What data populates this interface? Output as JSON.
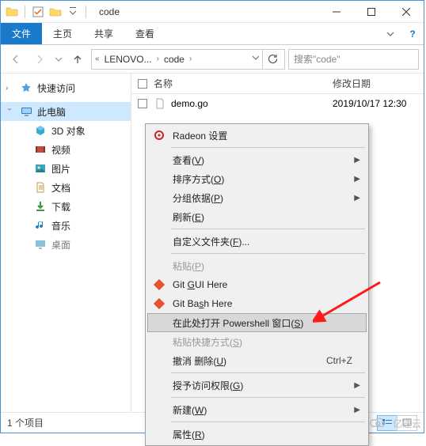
{
  "titlebar": {
    "title": "code"
  },
  "ribbon": {
    "file": "文件",
    "home": "主页",
    "share": "共享",
    "view": "查看"
  },
  "address": {
    "crumb1": "LENOVO...",
    "crumb2": "code",
    "search_placeholder": "搜索\"code\""
  },
  "sidebar": {
    "quick": "快速访问",
    "thispc": "此电脑",
    "objects3d": "3D 对象",
    "videos": "视频",
    "pictures": "图片",
    "documents": "文档",
    "downloads": "下载",
    "music": "音乐",
    "desktop": "桌面"
  },
  "columns": {
    "name": "名称",
    "date": "修改日期"
  },
  "files": [
    {
      "name": "demo.go",
      "date": "2019/10/17 12:30"
    }
  ],
  "status": {
    "count": "1 个项目"
  },
  "context_menu": {
    "radeon": "Radeon 设置",
    "view": "查看(V)",
    "sort": "排序方式(O)",
    "group": "分组依据(P)",
    "refresh": "刷新(E)",
    "customize": "自定义文件夹(F)...",
    "paste": "粘贴(P)",
    "gitgui": "Git GUI Here",
    "gitbash": "Git Bash Here",
    "powershell": "在此处打开 Powershell 窗口(S)",
    "paste_shortcut": "粘贴快捷方式(S)",
    "undo": "撤消 删除(U)",
    "undo_key": "Ctrl+Z",
    "grant_access": "授予访问权限(G)",
    "new": "新建(W)",
    "properties": "属性(R)"
  },
  "watermark": "亿速云"
}
